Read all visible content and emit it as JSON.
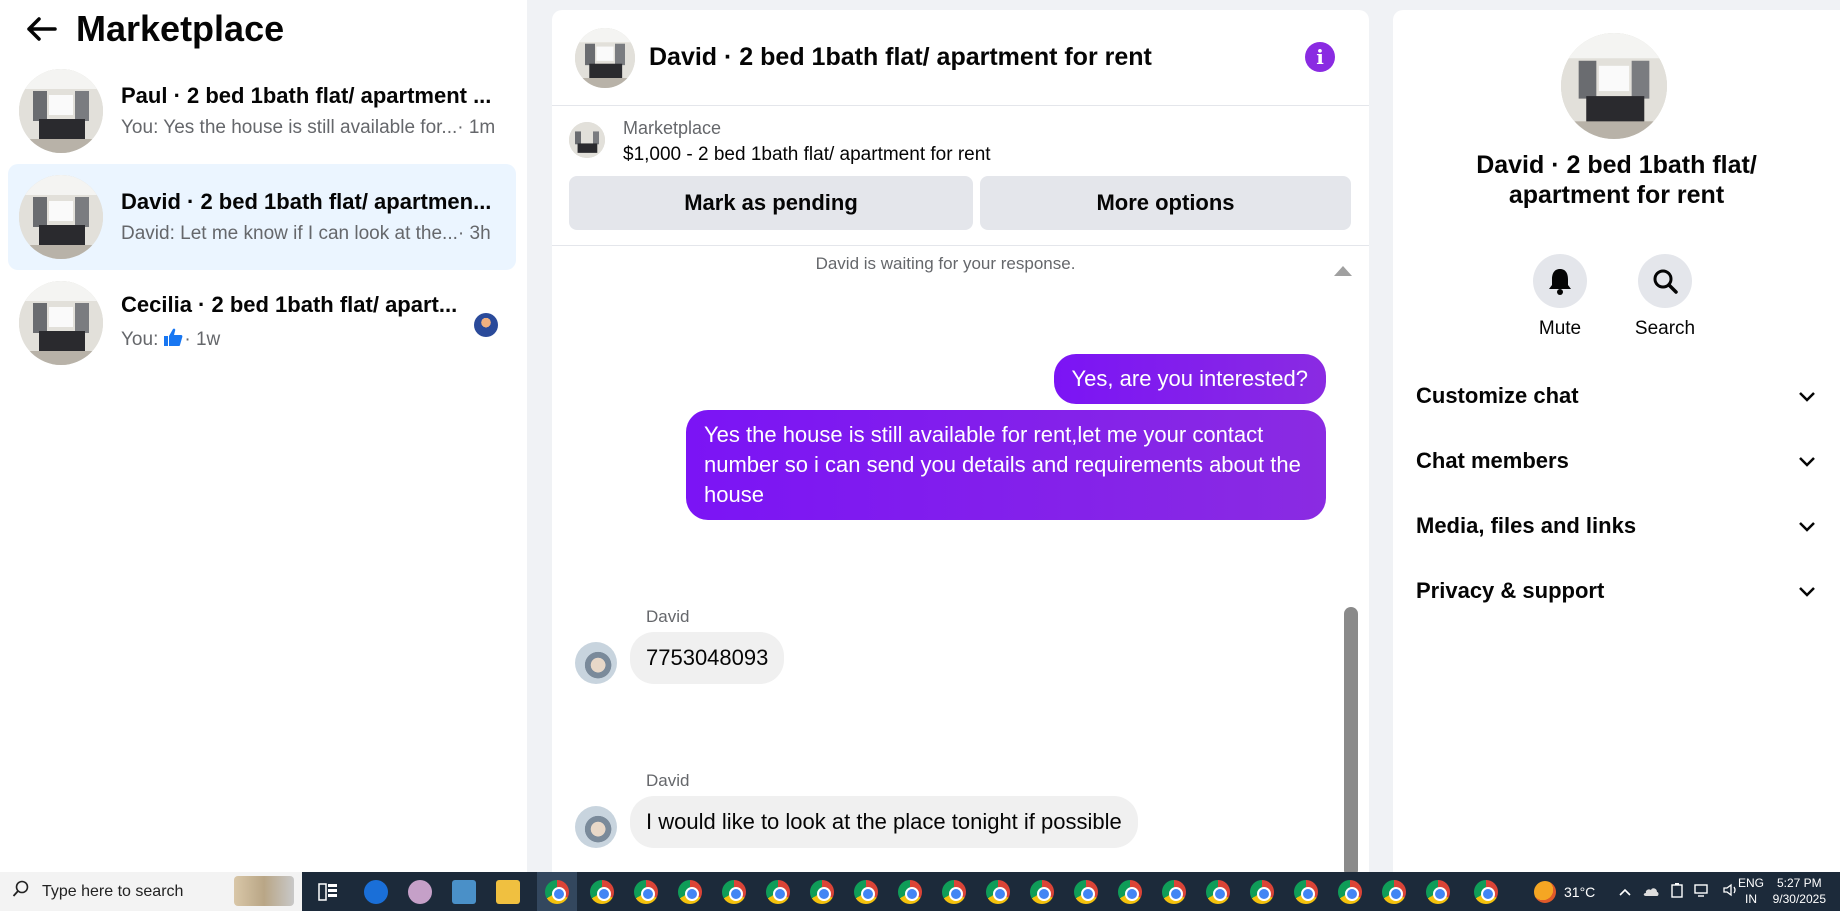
{
  "left_panel": {
    "title": "Marketplace",
    "conversations": [
      {
        "name": "Paul · 2 bed 1bath flat/ apartment ...",
        "preview": "You: Yes the house is still available for...",
        "time": " · 1m"
      },
      {
        "name": "David · 2 bed 1bath flat/ apartmen...",
        "preview": "David: Let me know if I can look at the...",
        "time": " · 3h"
      },
      {
        "name": "Cecilia · 2 bed 1bath flat/ apart...",
        "preview_prefix": "You: ",
        "time": " · 1w"
      }
    ]
  },
  "chat": {
    "title": "David · 2 bed 1bath flat/ apartment for rent",
    "listing_label": "Marketplace",
    "listing_price": "$1,000 - 2 bed 1bath flat/ apartment for rent",
    "mark_pending": "Mark as pending",
    "more_options": "More options",
    "waiting_text": "David is waiting for your response.",
    "outgoing": [
      "Yes, are you interested?",
      "Yes the house is still available for rent,let me your contact number so i can send you details and requirements about the house"
    ],
    "incoming": [
      {
        "sender": "David",
        "text": "7753048093"
      },
      {
        "sender": "David",
        "text": "I would like to look at the place tonight if possible"
      }
    ]
  },
  "details": {
    "title": "David · 2 bed 1bath flat/ apartment for rent",
    "mute": "Mute",
    "search": "Search",
    "sections": [
      "Customize chat",
      "Chat members",
      "Media, files and links",
      "Privacy & support"
    ]
  },
  "taskbar": {
    "search_placeholder": "Type here to search",
    "weather": "31°C",
    "lang_top": "ENG",
    "lang_bottom": "IN",
    "time": "5:27 PM",
    "date": "9/30/2025"
  },
  "colors": {
    "accent": "#8a2be2",
    "active_bg": "#ebf5ff",
    "taskbar": "#1c2a3a"
  }
}
